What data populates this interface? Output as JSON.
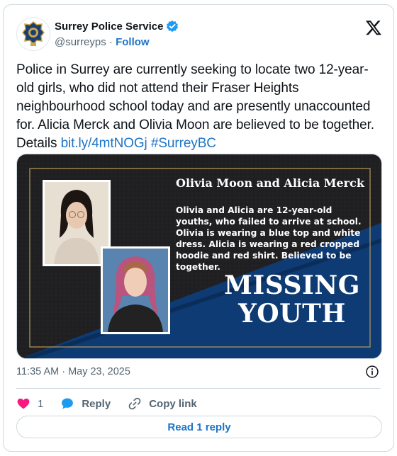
{
  "account": {
    "display_name": "Surrey Police Service",
    "handle": "@surreyps",
    "separator": "·",
    "follow_label": "Follow",
    "avatar_icon": "police-badge-icon",
    "verified_icon": "verified-badge-icon"
  },
  "tweet": {
    "text": "Police in Surrey are currently seeking to locate two 12-year-old girls, who did not attend their Fraser Heights neighbourhood school today and are presently unaccounted for. Alicia Merck and Olivia Moon are believed to be together. Details ",
    "link_text": "bit.ly/4mtNOGj",
    "hashtag": "#SurreyBC"
  },
  "media": {
    "title": "Olivia Moon and Alicia Merck",
    "description": "Olivia and Alicia are 12-year-old youths, who failed to arrive at school. Olivia is wearing a blue top and white dress. Alicia is wearing a red cropped hoodie and red shirt. Believed to be together.",
    "banner_line1": "MISSING",
    "banner_line2": "YOUTH",
    "colors": {
      "dark": "#1e1e1f",
      "blue": "#0e3b73",
      "gold": "#b89a5a"
    }
  },
  "footer": {
    "timestamp": "11:35 AM · May 23, 2025",
    "like_count": "1",
    "reply_label": "Reply",
    "copy_link_label": "Copy link",
    "read_replies_label": "Read 1 reply"
  },
  "colors": {
    "like": "#f91880",
    "reply": "#1d9bf0",
    "link": "#1d74c7"
  }
}
